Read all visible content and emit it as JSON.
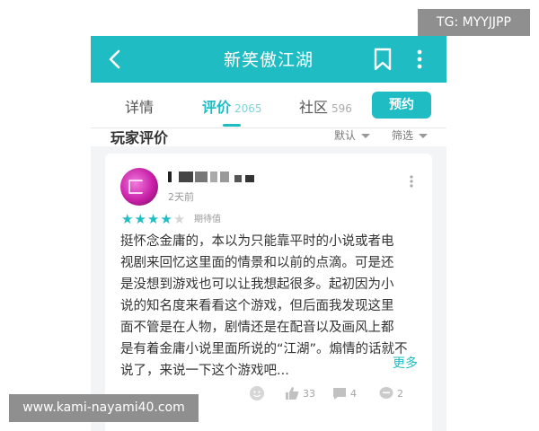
{
  "appbar": {
    "title": "新笑傲江湖"
  },
  "tabs": [
    {
      "label": "详情",
      "count": ""
    },
    {
      "label": "评价",
      "count": "2065"
    },
    {
      "label": "社区",
      "count": "596"
    }
  ],
  "reserve_label": "预约",
  "section": {
    "title": "玩家评价",
    "sort": "默认",
    "filter": "筛选"
  },
  "review": {
    "time": "2天前",
    "rating": 4,
    "rating_max": 5,
    "rating_label": "期待值",
    "text": "挺怀念金庸的，本以为只能靠平时的小说或者电\n视剧来回忆这里面的情景和以前的点滴。可是还\n是没想到游戏也可以让我想起很多。起初因为小\n说的知名度来看看这个游戏，但后面我发现这里\n面不管是在人物，剧情还是在配音以及画风上都\n是有着金庸小说里面所说的“江湖”。煽情的话就不\n说了，来说一下这个游戏吧...",
    "more_label": "更多",
    "likes": "33",
    "comments": "4",
    "shares": "2"
  },
  "watermarks": {
    "top": "TG: MYYJJPP",
    "bottom": "www.kami-nayami40.com"
  },
  "colors": {
    "accent": "#1fbcc3"
  }
}
